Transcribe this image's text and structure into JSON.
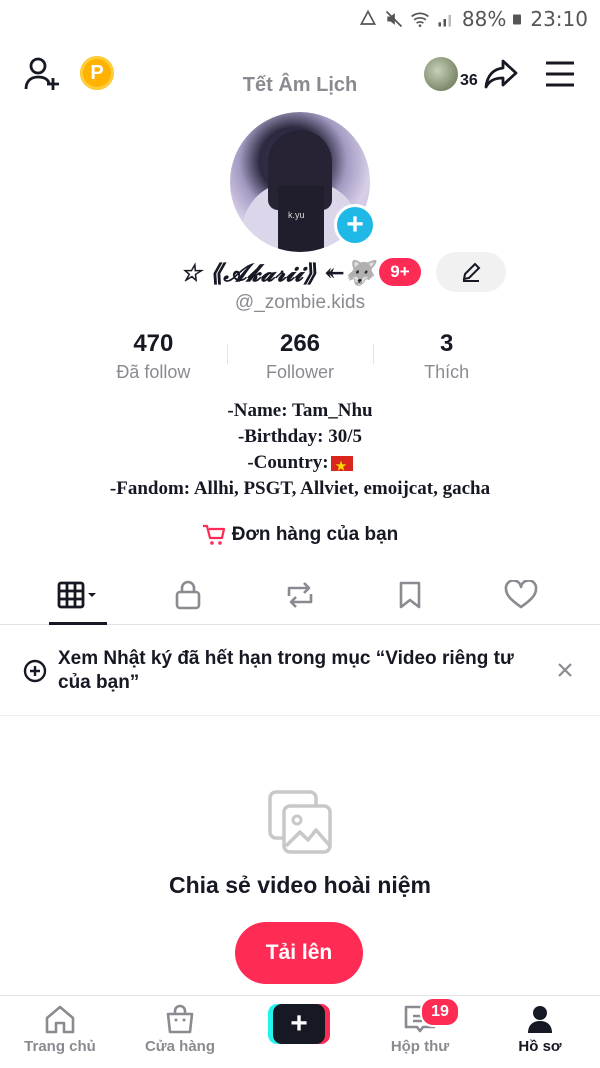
{
  "status_bar": {
    "battery": "88%",
    "time": "23:10"
  },
  "header": {
    "title": "Tết Âm Lịch",
    "coin_label": "P",
    "story_count": "36"
  },
  "profile": {
    "display_name": "☆ ⟪𝓐𝓴𝓪𝓻𝓲𝓲⟫ ↞🐺",
    "badge": "9+",
    "username": "@_zombie.kids",
    "avatar_caption": "k.yu"
  },
  "stats": [
    {
      "value": "470",
      "label": "Đã follow"
    },
    {
      "value": "266",
      "label": "Follower"
    },
    {
      "value": "3",
      "label": "Thích"
    }
  ],
  "bio": {
    "line1": "-Name: Tam_Nhu",
    "line2": "-Birthday: 30/5",
    "line3": "-Country:",
    "line4": "-Fandom: Allhi, PSGT, Allviet, emoijcat, gacha"
  },
  "orders": {
    "label": "Đơn hàng của bạn"
  },
  "tabs": [
    {
      "icon": "grid-icon",
      "active": true
    },
    {
      "icon": "lock-icon",
      "active": false
    },
    {
      "icon": "repost-icon",
      "active": false
    },
    {
      "icon": "bookmark-icon",
      "active": false
    },
    {
      "icon": "heart-icon",
      "active": false
    }
  ],
  "notice": {
    "text": "Xem Nhật ký đã hết hạn trong mục “Video riêng tư của bạn”"
  },
  "empty_state": {
    "title": "Chia sẻ video hoài niệm",
    "button": "Tải lên"
  },
  "bottom_nav": {
    "home": "Trang chủ",
    "shop": "Cửa hàng",
    "inbox": "Hộp thư",
    "inbox_badge": "19",
    "profile": "Hồ sơ"
  },
  "colors": {
    "accent": "#fe2c55",
    "cyan": "#25f4ee",
    "text": "#161823",
    "muted": "#8a8b91"
  }
}
